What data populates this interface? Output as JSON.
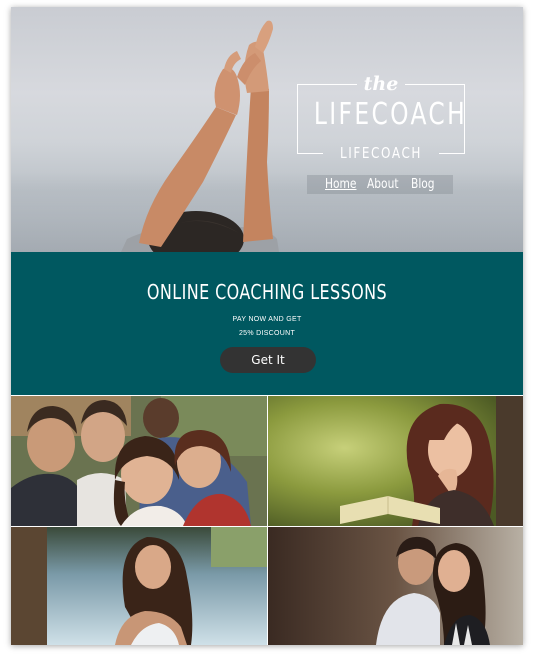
{
  "colors": {
    "promo_background": "#005860",
    "cta_background": "#333333",
    "text": "#ffffff"
  },
  "logo": {
    "the": "the",
    "title": "LIFECOACH",
    "subtitle": "LIFECOACH"
  },
  "nav": {
    "items": [
      {
        "label": "Home",
        "active": true
      },
      {
        "label": "About",
        "active": false
      },
      {
        "label": "Blog",
        "active": false
      }
    ]
  },
  "promo": {
    "title": "ONLINE COACHING LESSONS",
    "line1": "PAY NOW AND GET",
    "line2": "25% DISCOUNT",
    "cta_label": "Get It"
  },
  "gallery": {
    "tiles": [
      {
        "name": "gallery-photo-group-friends"
      },
      {
        "name": "gallery-photo-woman-reading"
      },
      {
        "name": "gallery-photo-woman-smiling"
      },
      {
        "name": "gallery-photo-couple"
      }
    ]
  }
}
